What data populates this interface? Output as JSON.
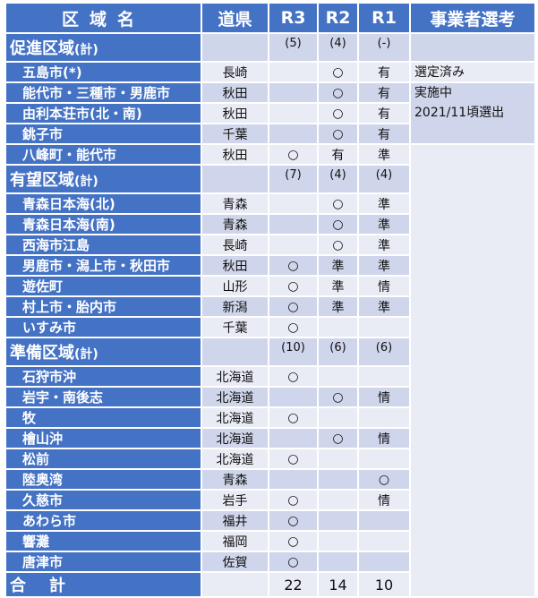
{
  "header": {
    "name": "区域名",
    "prefecture": "道県",
    "r3": "R3",
    "r2": "R2",
    "r1": "R1",
    "selection": "事業者選考"
  },
  "sections": [
    {
      "name": "促進区域",
      "suffix": "(計)",
      "r3": "(5)",
      "r2": "(4)",
      "r1": "(-)",
      "items": [
        {
          "name": "五島市(*)",
          "pref": "長崎",
          "r3": "",
          "r2": "○",
          "r1": "有"
        },
        {
          "name": "能代市・三種市・男鹿市",
          "pref": "秋田",
          "r3": "",
          "r2": "○",
          "r1": "有"
        },
        {
          "name": "由利本荘市(北・南)",
          "pref": "秋田",
          "r3": "",
          "r2": "○",
          "r1": "有"
        },
        {
          "name": "銚子市",
          "pref": "千葉",
          "r3": "",
          "r2": "○",
          "r1": "有"
        },
        {
          "name": "八峰町・能代市",
          "pref": "秋田",
          "r3": "○",
          "r2": "有",
          "r1": "準"
        }
      ]
    },
    {
      "name": "有望区域",
      "suffix": "(計)",
      "r3": "(7)",
      "r2": "(4)",
      "r1": "(4)",
      "items": [
        {
          "name": "青森日本海(北)",
          "pref": "青森",
          "r3": "",
          "r2": "○",
          "r1": "準"
        },
        {
          "name": "青森日本海(南)",
          "pref": "青森",
          "r3": "",
          "r2": "○",
          "r1": "準"
        },
        {
          "name": "西海市江島",
          "pref": "長崎",
          "r3": "",
          "r2": "○",
          "r1": "準"
        },
        {
          "name": "男鹿市・潟上市・秋田市",
          "pref": "秋田",
          "r3": "○",
          "r2": "準",
          "r1": "準"
        },
        {
          "name": "遊佐町",
          "pref": "山形",
          "r3": "○",
          "r2": "準",
          "r1": "情"
        },
        {
          "name": "村上市・胎内市",
          "pref": "新潟",
          "r3": "○",
          "r2": "準",
          "r1": "準"
        },
        {
          "name": "いすみ市",
          "pref": "千葉",
          "r3": "○",
          "r2": "",
          "r1": ""
        }
      ]
    },
    {
      "name": "準備区域",
      "suffix": "(計)",
      "r3": "(10)",
      "r2": "(6)",
      "r1": "(6)",
      "items": [
        {
          "name": "石狩市沖",
          "pref": "北海道",
          "r3": "○",
          "r2": "",
          "r1": ""
        },
        {
          "name": "岩宇・南後志",
          "pref": "北海道",
          "r3": "",
          "r2": "○",
          "r1": "情"
        },
        {
          "name": "牧",
          "pref": "北海道",
          "r3": "○",
          "r2": "",
          "r1": ""
        },
        {
          "name": "檜山沖",
          "pref": "北海道",
          "r3": "",
          "r2": "○",
          "r1": "情"
        },
        {
          "name": "松前",
          "pref": "北海道",
          "r3": "○",
          "r2": "",
          "r1": ""
        },
        {
          "name": "陸奥湾",
          "pref": "青森",
          "r3": "",
          "r2": "",
          "r1": "○"
        },
        {
          "name": "久慈市",
          "pref": "岩手",
          "r3": "○",
          "r2": "",
          "r1": "情"
        },
        {
          "name": "あわら市",
          "pref": "福井",
          "r3": "○",
          "r2": "",
          "r1": ""
        },
        {
          "name": "響灘",
          "pref": "福岡",
          "r3": "○",
          "r2": "",
          "r1": ""
        },
        {
          "name": "唐津市",
          "pref": "佐賀",
          "r3": "○",
          "r2": "",
          "r1": ""
        }
      ]
    }
  ],
  "selection": {
    "goto": "選定済み",
    "akita_line1": "実施中",
    "akita_line2": "2021/11頃選出"
  },
  "total": {
    "label": "合計",
    "r3": "22",
    "r2": "14",
    "r1": "10"
  },
  "colors": {
    "header_blue": "#4472C4",
    "row_dark": "#CFD5EA",
    "row_light": "#E9EBF5"
  }
}
